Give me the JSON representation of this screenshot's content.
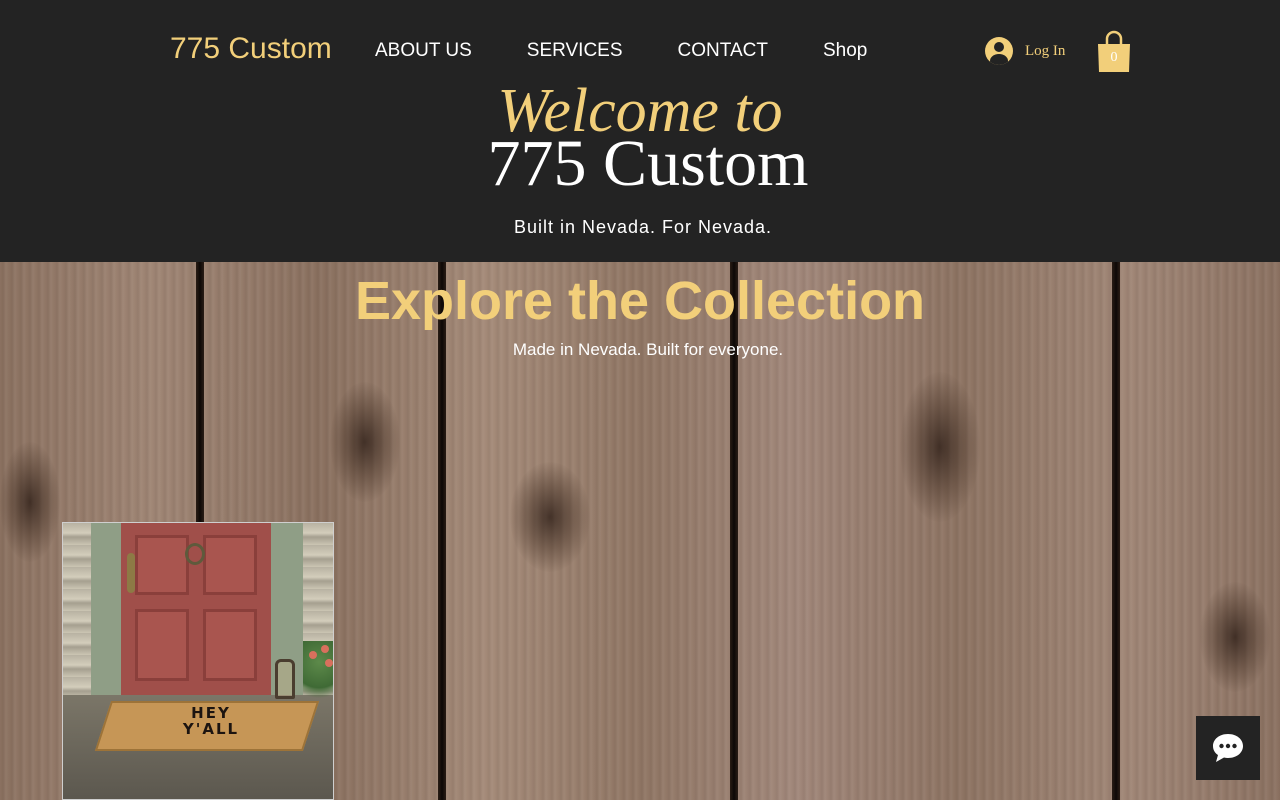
{
  "header": {
    "brand": "775 Custom",
    "nav": [
      {
        "label": "ABOUT US"
      },
      {
        "label": "SERVICES"
      },
      {
        "label": "CONTACT"
      },
      {
        "label": "Shop"
      }
    ],
    "login_label": "Log In",
    "cart_count": "0",
    "icons": {
      "login": "user-avatar-icon",
      "cart": "shopping-bag-icon"
    }
  },
  "hero_header": {
    "welcome": "Welcome to",
    "title": "775 Custom",
    "tagline": "Built in Nevada.  For Nevada."
  },
  "collection": {
    "heading": "Explore the Collection",
    "subheading": "Made in Nevada. Built for everyone.",
    "product_image": {
      "mat_text_line1": "HEY",
      "mat_text_line2": "Y'ALL"
    }
  },
  "chat": {
    "icon": "chat-bubble-icon"
  },
  "colors": {
    "background": "#232323",
    "accent": "#f2cf7a",
    "text": "#ffffff"
  }
}
